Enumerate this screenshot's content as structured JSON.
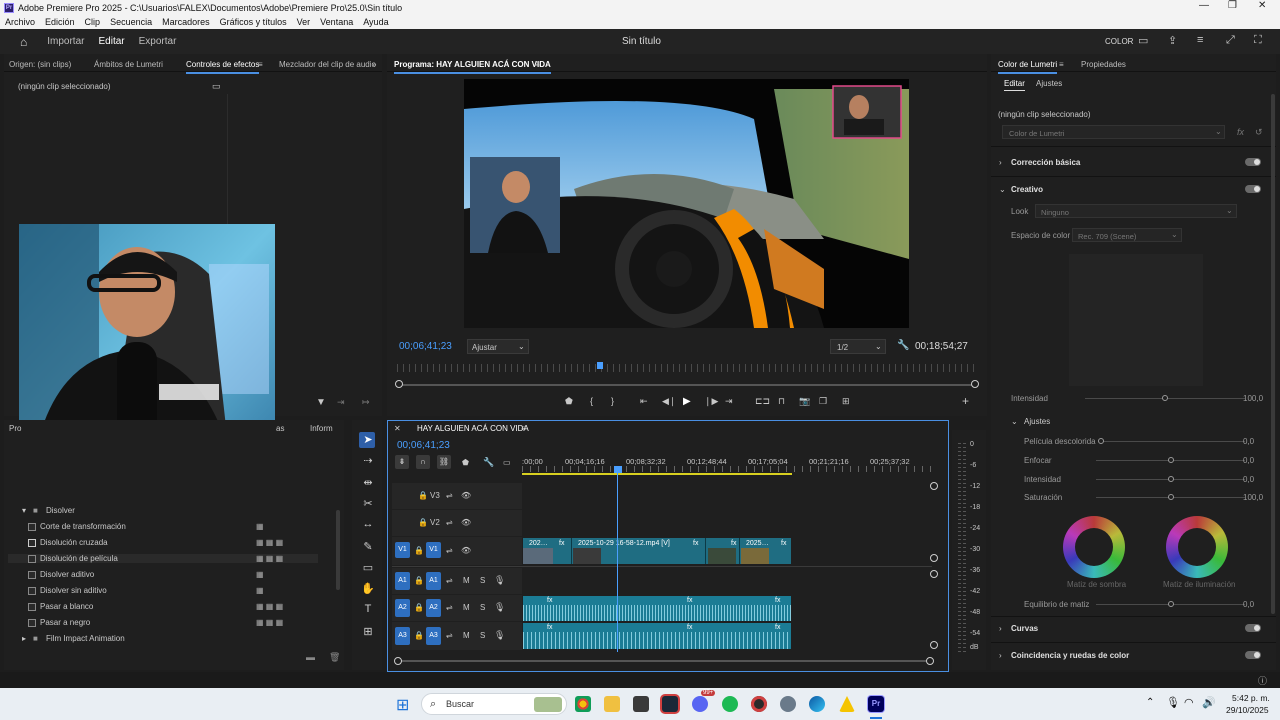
{
  "window": {
    "title": "Adobe Premiere Pro 2025 - C:\\Usuarios\\FALEX\\Documentos\\Adobe\\Premiere Pro\\25.0\\Sin título",
    "app_badge": "Pr"
  },
  "menu": [
    "Archivo",
    "Edición",
    "Clip",
    "Secuencia",
    "Marcadores",
    "Gráficos y títulos",
    "Ver",
    "Ventana",
    "Ayuda"
  ],
  "header": {
    "nav": [
      "Importar",
      "Editar",
      "Exportar"
    ],
    "active": "Editar",
    "project_title": "Sin título",
    "workspace_label": "COLOR"
  },
  "source_panel": {
    "tabs": [
      "Origen: (sin clips)",
      "Ámbitos de Lumetri",
      "Controles de efectos",
      "Mezclador del clip de audio"
    ],
    "active_tab": "Controles de efectos",
    "empty_text": "(ningún clip seleccionado)"
  },
  "project_panel": {
    "tabs_partial": [
      "Pro",
      "as",
      "Inform"
    ],
    "folder": "Disolver",
    "items": [
      "Corte de transformación",
      "Disolución cruzada",
      "Disolución de película",
      "Disolver aditivo",
      "Disolver sin aditivo",
      "Pasar a blanco",
      "Pasar a negro"
    ],
    "folder2": "Film Impact Animation"
  },
  "program_monitor": {
    "title": "Programa: HAY ALGUIEN ACÁ CON VIDA",
    "timecode": "00;06;41;23",
    "fit": "Ajustar",
    "resolution": "1/2",
    "duration": "00;18;54;27",
    "playhead_fraction": 0.35
  },
  "timeline": {
    "title": "HAY ALGUIEN ACÁ CON VIDA",
    "timecode": "00;06;41;23",
    "ruler": [
      ":00;00",
      "00;04;16;16",
      "00;08;32;32",
      "00;12;48;44",
      "00;17;05;04",
      "00;21;21;16",
      "00;25;37;32"
    ],
    "tracks": [
      "V3",
      "V2",
      "V1",
      "A1",
      "A2",
      "A3"
    ],
    "clip_labels": [
      "202…",
      "2025-10-29 16-58-12.mp4 [V]",
      "2025…"
    ],
    "meter_ticks": [
      "0",
      "-6",
      "-12",
      "-18",
      "-24",
      "-30",
      "-36",
      "-42",
      "-48",
      "-54",
      "dB"
    ]
  },
  "lumetri": {
    "tabs": [
      "Color de Lumetri",
      "Propiedades"
    ],
    "subtabs": [
      "Editar",
      "Ajustes"
    ],
    "no_clip": "(ningún clip seleccionado)",
    "dropdown": "Color de Lumetri",
    "sections": [
      "Corrección básica",
      "Creativo"
    ],
    "look_label": "Look",
    "look_value": "Ninguno",
    "colorspace_label": "Espacio de color",
    "colorspace_value": "Rec. 709 (Scene)",
    "intensity_label": "Intensidad",
    "intensity_value": "100,0",
    "adjust_title": "Ajustes",
    "adjust_rows": [
      {
        "label": "Película descolorida",
        "value": "0,0"
      },
      {
        "label": "Enfocar",
        "value": "0,0"
      },
      {
        "label": "Intensidad",
        "value": "0,0"
      },
      {
        "label": "Saturación",
        "value": "100,0"
      }
    ],
    "wheel_labels": [
      "Matiz de sombra",
      "Matiz de iluminación"
    ],
    "balance_label": "Equilibrio de matiz",
    "balance_value": "0,0",
    "bottom_sections": [
      "Curvas",
      "Coincidencia y ruedas de color"
    ]
  },
  "taskbar": {
    "search": "Buscar",
    "time": "5:42 p. m.",
    "date": "29/10/2025",
    "badge": "99+"
  }
}
